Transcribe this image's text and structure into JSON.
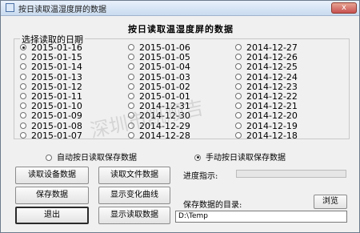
{
  "window": {
    "title": "按日读取温湿度屏的数据",
    "close": "x"
  },
  "header": "按日读取温湿度屏的数据",
  "date_group": {
    "legend": "选择读取的日期"
  },
  "dates": [
    {
      "label": "2015-01-16",
      "selected": true
    },
    {
      "label": "2015-01-15",
      "selected": false
    },
    {
      "label": "2015-01-14",
      "selected": false
    },
    {
      "label": "2015-01-13",
      "selected": false
    },
    {
      "label": "2015-01-12",
      "selected": false
    },
    {
      "label": "2015-01-11",
      "selected": false
    },
    {
      "label": "2015-01-10",
      "selected": false
    },
    {
      "label": "2015-01-09",
      "selected": false
    },
    {
      "label": "2015-01-08",
      "selected": false
    },
    {
      "label": "2015-01-07",
      "selected": false
    },
    {
      "label": "2015-01-06",
      "selected": false
    },
    {
      "label": "2015-01-05",
      "selected": false
    },
    {
      "label": "2015-01-04",
      "selected": false
    },
    {
      "label": "2015-01-03",
      "selected": false
    },
    {
      "label": "2015-01-02",
      "selected": false
    },
    {
      "label": "2015-01-01",
      "selected": false
    },
    {
      "label": "2014-12-31",
      "selected": false
    },
    {
      "label": "2014-12-30",
      "selected": false
    },
    {
      "label": "2014-12-29",
      "selected": false
    },
    {
      "label": "2014-12-28",
      "selected": false
    },
    {
      "label": "2014-12-27",
      "selected": false
    },
    {
      "label": "2014-12-26",
      "selected": false
    },
    {
      "label": "2014-12-25",
      "selected": false
    },
    {
      "label": "2014-12-24",
      "selected": false
    },
    {
      "label": "2014-12-23",
      "selected": false
    },
    {
      "label": "2014-12-22",
      "selected": false
    },
    {
      "label": "2014-12-21",
      "selected": false
    },
    {
      "label": "2014-12-20",
      "selected": false
    },
    {
      "label": "2014-12-19",
      "selected": false
    },
    {
      "label": "2014-12-18",
      "selected": false
    }
  ],
  "modes": {
    "auto": "自动按日读取保存数据",
    "manual": "手动按日读取保存数据",
    "selected": "manual"
  },
  "buttons": {
    "read_device": "读取设备数据",
    "read_file": "读取文件数据",
    "save": "保存数据",
    "show_curve": "显示变化曲线",
    "exit": "退出",
    "show_read": "显示读取数据",
    "browse": "浏览"
  },
  "progress": {
    "label": "进度指示:",
    "value": 0
  },
  "save_dir": {
    "label": "保存数据的目录:",
    "value": "D:\\Temp"
  },
  "watermark": "深圳市凯顺吉"
}
